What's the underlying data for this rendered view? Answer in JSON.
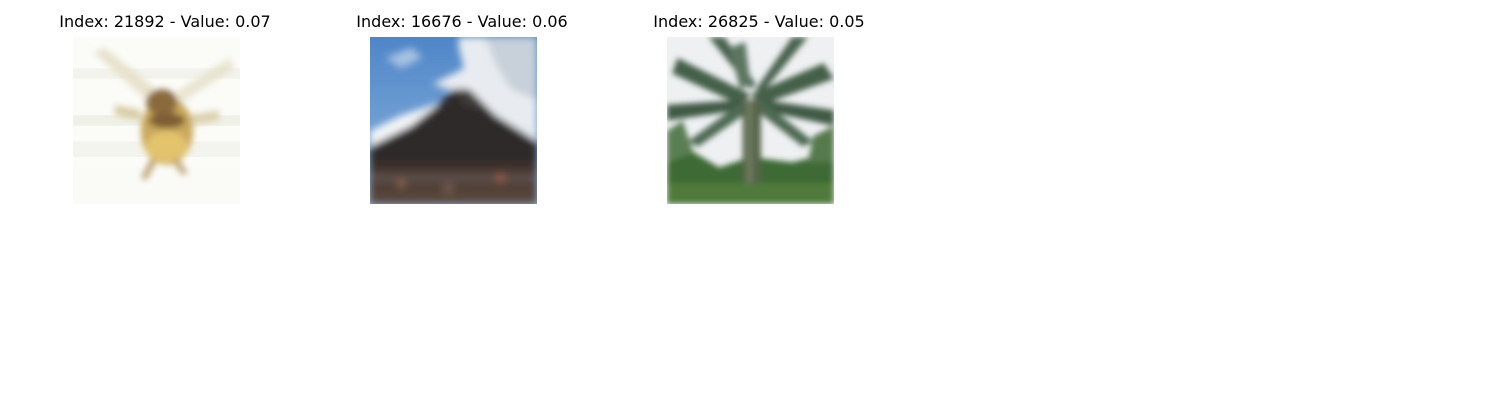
{
  "panels": [
    {
      "title": "Index: 21892 - Value: 0.07",
      "index": 21892,
      "value": 0.07,
      "image": "insect-in-flight"
    },
    {
      "title": "Index: 16676 - Value: 0.06",
      "index": 16676,
      "value": 0.06,
      "image": "volcano-under-cloudy-sky"
    },
    {
      "title": "Index: 26825 - Value: 0.05",
      "index": 26825,
      "value": 0.05,
      "image": "palm-tree"
    }
  ]
}
